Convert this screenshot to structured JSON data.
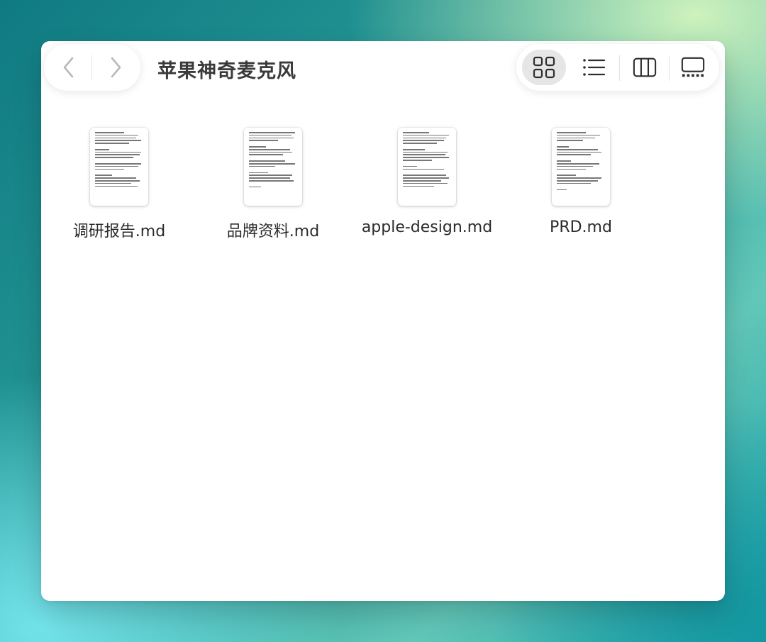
{
  "window": {
    "title": "苹果神奇麦克风"
  },
  "toolbar": {
    "nav": {
      "back_icon": "chevron-left-icon",
      "forward_icon": "chevron-right-icon"
    },
    "view_modes": [
      {
        "icon": "grid-view-icon",
        "active": true
      },
      {
        "icon": "list-view-icon",
        "active": false
      },
      {
        "icon": "column-view-icon",
        "active": false
      },
      {
        "icon": "gallery-view-icon",
        "active": false
      }
    ]
  },
  "files": [
    {
      "name": "调研报告.md",
      "icon": "markdown-document-thumbnail"
    },
    {
      "name": "品牌资料.md",
      "icon": "markdown-document-thumbnail"
    },
    {
      "name": "apple-design.md",
      "icon": "markdown-document-thumbnail"
    },
    {
      "name": "PRD.md",
      "icon": "markdown-document-thumbnail"
    }
  ],
  "colors": {
    "window_bg": "#ffffff",
    "title_text": "#3a3a3a",
    "active_view_bg": "#e6e6e6",
    "icon_stroke": "#2e2e2e"
  }
}
